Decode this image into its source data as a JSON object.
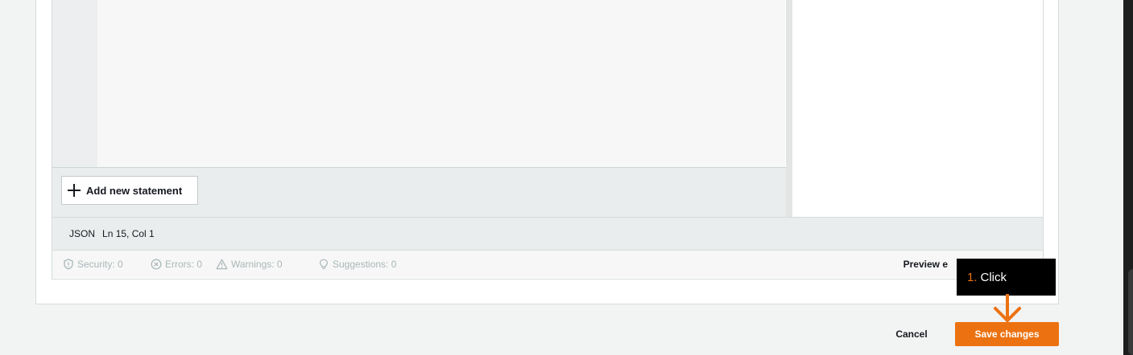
{
  "editor": {
    "add_statement_label": "Add new statement"
  },
  "status_bar": {
    "language": "JSON",
    "cursor_position": "Ln 15, Col 1"
  },
  "validation": {
    "items": [
      {
        "icon": "shield-icon",
        "label": "Security: 0"
      },
      {
        "icon": "error-circle-icon",
        "label": "Errors: 0"
      },
      {
        "icon": "warning-triangle-icon",
        "label": "Warnings: 0"
      },
      {
        "icon": "lightbulb-icon",
        "label": "Suggestions: 0"
      }
    ],
    "preview_label": "Preview e"
  },
  "actions": {
    "cancel_label": "Cancel",
    "save_label": "Save changes"
  },
  "callout": {
    "step": "1.",
    "text": "Click"
  },
  "colors": {
    "accent": "#ec7211",
    "background": "#f2f3f3",
    "muted_text": "#aab7b8"
  }
}
